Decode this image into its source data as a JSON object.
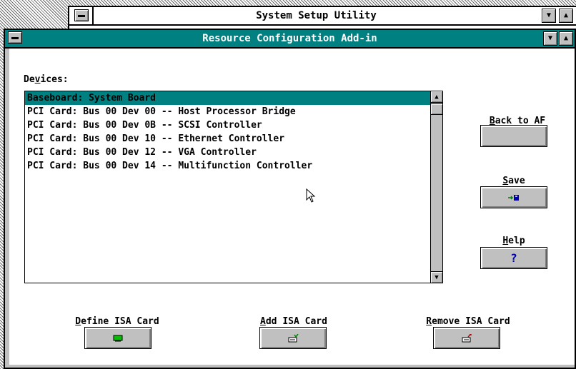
{
  "outer_window": {
    "title": "System Setup Utility"
  },
  "inner_window": {
    "title": "Resource Configuration Add-in"
  },
  "devices": {
    "label_pre": "De",
    "label_accel": "v",
    "label_post": "ices:",
    "items": [
      "Baseboard: System Board",
      "PCI Card: Bus 00 Dev 00 -- Host Processor Bridge",
      "PCI Card: Bus 00 Dev 0B -- SCSI Controller",
      "PCI Card: Bus 00 Dev 10 -- Ethernet Controller",
      "PCI Card: Bus 00 Dev 12 -- VGA Controller",
      "PCI Card: Bus 00 Dev 14 -- Multifunction Controller"
    ],
    "selected_index": 0
  },
  "buttons": {
    "back": {
      "accel": "B",
      "rest": "ack to AF"
    },
    "save": {
      "accel": "S",
      "rest": "ave",
      "icon": "save-disk-icon"
    },
    "help": {
      "accel": "H",
      "rest": "elp",
      "icon_text": "?"
    },
    "define_isa": {
      "accel": "D",
      "rest": "efine ISA Card",
      "icon": "isa-card-icon"
    },
    "add_isa": {
      "accel": "A",
      "rest": "dd ISA Card",
      "icon": "add-card-icon"
    },
    "remove_isa": {
      "accel": "R",
      "rest": "emove ISA Card",
      "icon": "remove-card-icon"
    }
  },
  "colors": {
    "titlebar": "#008080",
    "selection": "#008080",
    "face": "#c0c0c0",
    "help_icon": "#0000aa"
  }
}
